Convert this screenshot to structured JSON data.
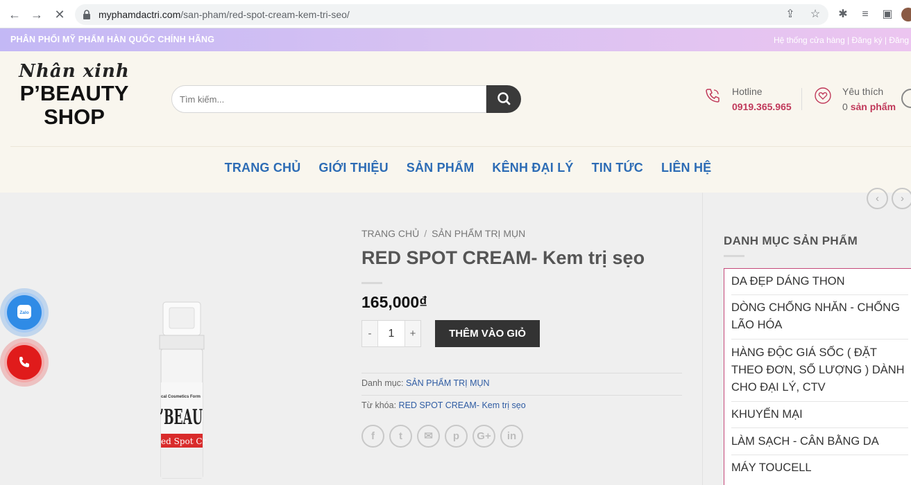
{
  "browser": {
    "url_domain": "myphamdactri.com",
    "url_path": "/san-pham/red-spot-cream-kem-tri-seo/"
  },
  "top_strip": {
    "promo": "PHÂN PHỐI MỸ PHẨM HÀN QUỐC CHÍNH HÃNG",
    "links": "Hệ thống cửa hàng | Đăng ký | Đăng n"
  },
  "logo": {
    "script": "Nhân xinh",
    "line1": "P’BEAUTY",
    "line2": "SHOP"
  },
  "search": {
    "placeholder": "Tìm kiếm..."
  },
  "hotline": {
    "label": "Hotline",
    "number": "0919.365.965"
  },
  "favorites": {
    "label": "Yêu thích",
    "count": "0",
    "unit": "sản phẩm"
  },
  "nav": [
    "TRANG CHỦ",
    "GIỚI THIỆU",
    "SẢN PHẨM",
    "KÊNH ĐẠI LÝ",
    "TIN TỨC",
    "LIÊN HỆ"
  ],
  "product": {
    "breadcrumb_home": "TRANG CHỦ",
    "breadcrumb_sep": "/",
    "breadcrumb_cat": "SẢN PHẨM TRỊ MỤN",
    "title": "RED SPOT CREAM- Kem trị sẹo",
    "price": "165,000₫",
    "qty_minus": "-",
    "qty_value": "1",
    "qty_plus": "+",
    "add_to_cart": "THÊM VÀO GIỎ",
    "category_label": "Danh mục:",
    "category_value": "SẢN PHẨM TRỊ MỤN",
    "tag_label": "Từ khóa:",
    "tag_value": "RED SPOT CREAM- Kem trị sẹo",
    "image_text_1": "cal Cosmetics Form",
    "image_text_2": "’BEAU",
    "image_text_3": "ed Spot Cr"
  },
  "share_icons": [
    "f",
    "t",
    "✉",
    "p",
    "G+",
    "in"
  ],
  "sidebar": {
    "title": "DANH MỤC SẢN PHẨM",
    "categories": [
      "DA ĐẸP DÁNG THON",
      "DÒNG CHỐNG NHĂN - CHỐNG LÃO HÓA",
      "HÀNG ĐỘC GIÁ SỐC ( ĐẶT THEO ĐƠN, SỐ LƯỢNG ) DÀNH CHO ĐẠI LÝ, CTV",
      "KHUYẾN MẠI",
      "LÀM SẠCH - CÂN BẰNG DA",
      "MÁY TOUCELL"
    ]
  },
  "float": {
    "zalo_label": "Zalo"
  },
  "colors": {
    "accent": "#c0395a",
    "nav": "#2d6cb5",
    "button_dark": "#333333"
  }
}
